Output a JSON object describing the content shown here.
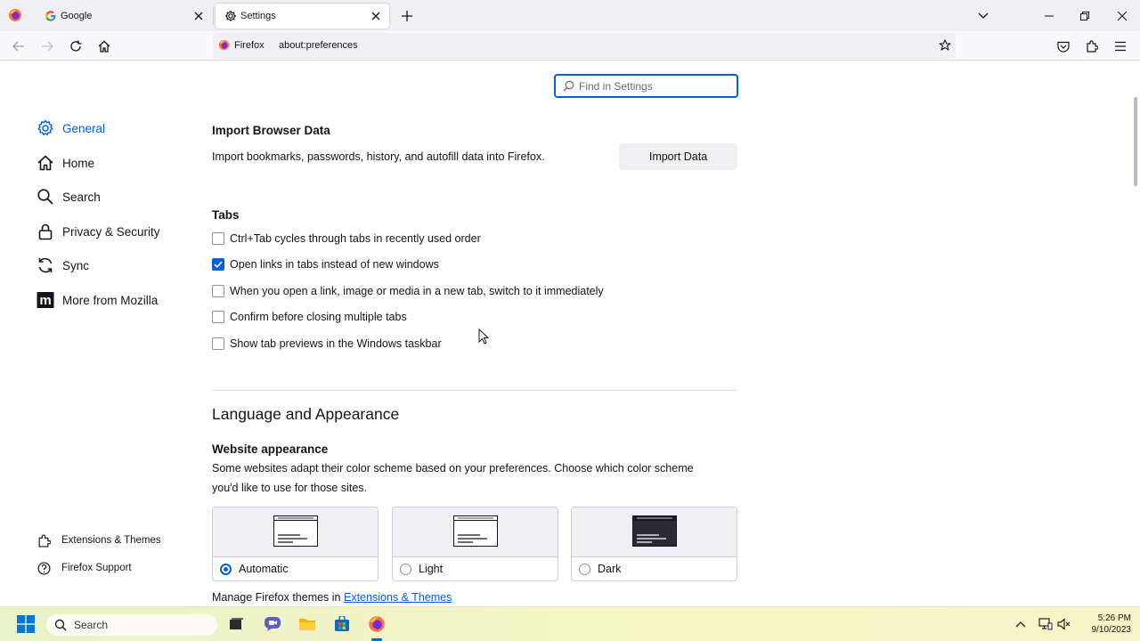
{
  "browser": {
    "tabs": [
      {
        "label": "Google",
        "icon": "google-icon",
        "active": false
      },
      {
        "label": "Settings",
        "icon": "gear-icon",
        "active": true
      }
    ],
    "identity_label": "Firefox",
    "url": "about:preferences"
  },
  "settings": {
    "search_placeholder": "Find in Settings",
    "categories": [
      {
        "label": "General",
        "icon": "gear-icon",
        "selected": true
      },
      {
        "label": "Home",
        "icon": "home-icon"
      },
      {
        "label": "Search",
        "icon": "search-icon"
      },
      {
        "label": "Privacy & Security",
        "icon": "lock-icon"
      },
      {
        "label": "Sync",
        "icon": "sync-icon"
      },
      {
        "label": "More from Mozilla",
        "icon": "mozilla-icon"
      }
    ],
    "footer": [
      {
        "label": "Extensions & Themes",
        "icon": "puzzle-icon"
      },
      {
        "label": "Firefox Support",
        "icon": "help-icon"
      }
    ],
    "import": {
      "heading": "Import Browser Data",
      "description": "Import bookmarks, passwords, history, and autofill data into Firefox.",
      "button": "Import Data"
    },
    "tabs": {
      "heading": "Tabs",
      "options": [
        {
          "label": "Ctrl+Tab cycles through tabs in recently used order",
          "checked": false
        },
        {
          "label": "Open links in tabs instead of new windows",
          "checked": true
        },
        {
          "label": "When you open a link, image or media in a new tab, switch to it immediately",
          "checked": false
        },
        {
          "label": "Confirm before closing multiple tabs",
          "checked": false
        },
        {
          "label": "Show tab previews in the Windows taskbar",
          "checked": false
        }
      ]
    },
    "language_appearance": {
      "heading": "Language and Appearance",
      "website_appearance": {
        "heading": "Website appearance",
        "description_line1": "Some websites adapt their color scheme based on your preferences. Choose which color scheme",
        "description_line2": "you'd like to use for those sites.",
        "options": [
          {
            "label": "Automatic",
            "selected": true
          },
          {
            "label": "Light",
            "selected": false
          },
          {
            "label": "Dark",
            "selected": false
          }
        ],
        "manage_prefix": "Manage Firefox themes in",
        "manage_link": "Extensions & Themes"
      }
    }
  },
  "taskbar": {
    "search_label": "Search",
    "time": "5:26 PM",
    "date": "9/10/2023"
  },
  "colors": {
    "accent": "#0061e0",
    "tabstrip": "#f0f0f4"
  }
}
